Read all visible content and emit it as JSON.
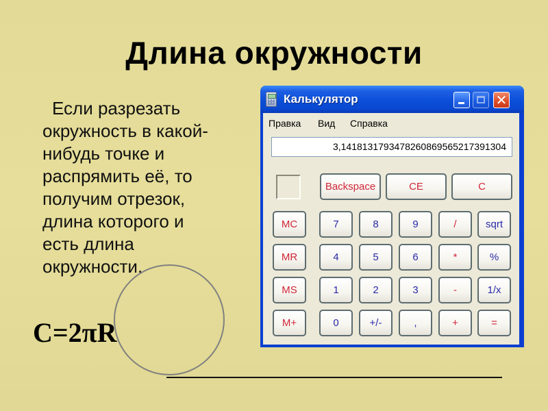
{
  "slide": {
    "title": "Длина окружности",
    "body_lines": [
      "Если разрезать",
      "окружность в какой-",
      "нибудь точке и",
      "распрямить её, то",
      "получим отрезок,",
      "длина которого и",
      "есть длина",
      "окружности."
    ],
    "formula": "C=2πR"
  },
  "calculator": {
    "title": "Калькулятор",
    "icon": "calculator-icon",
    "controls": {
      "minimize": "minimize-icon",
      "maximize": "maximize-icon",
      "close": "✕"
    },
    "menu": [
      "Правка",
      "Вид",
      "Справка"
    ],
    "display_value": "3,1418131793478260869565217391304",
    "top_keys": [
      {
        "label": "Backspace",
        "color": "red"
      },
      {
        "label": "CE",
        "color": "red"
      },
      {
        "label": "C",
        "color": "red"
      }
    ],
    "rows": [
      [
        {
          "label": "MC",
          "color": "red"
        },
        {
          "label": "7",
          "color": "blue"
        },
        {
          "label": "8",
          "color": "blue"
        },
        {
          "label": "9",
          "color": "blue"
        },
        {
          "label": "/",
          "color": "red"
        },
        {
          "label": "sqrt",
          "color": "blue"
        }
      ],
      [
        {
          "label": "MR",
          "color": "red"
        },
        {
          "label": "4",
          "color": "blue"
        },
        {
          "label": "5",
          "color": "blue"
        },
        {
          "label": "6",
          "color": "blue"
        },
        {
          "label": "*",
          "color": "red"
        },
        {
          "label": "%",
          "color": "blue"
        }
      ],
      [
        {
          "label": "MS",
          "color": "red"
        },
        {
          "label": "1",
          "color": "blue"
        },
        {
          "label": "2",
          "color": "blue"
        },
        {
          "label": "3",
          "color": "blue"
        },
        {
          "label": "-",
          "color": "red"
        },
        {
          "label": "1/x",
          "color": "blue"
        }
      ],
      [
        {
          "label": "M+",
          "color": "red"
        },
        {
          "label": "0",
          "color": "blue"
        },
        {
          "label": "+/-",
          "color": "blue"
        },
        {
          "label": ",",
          "color": "blue"
        },
        {
          "label": "+",
          "color": "red"
        },
        {
          "label": "=",
          "color": "red"
        }
      ]
    ]
  },
  "colors": {
    "background": "#e3db97",
    "titlebar": "#0b4fd8",
    "window_face": "#ece9d8",
    "key_red": "#d0283a",
    "key_blue": "#2a2aa8",
    "circle_stroke": "#808080"
  }
}
